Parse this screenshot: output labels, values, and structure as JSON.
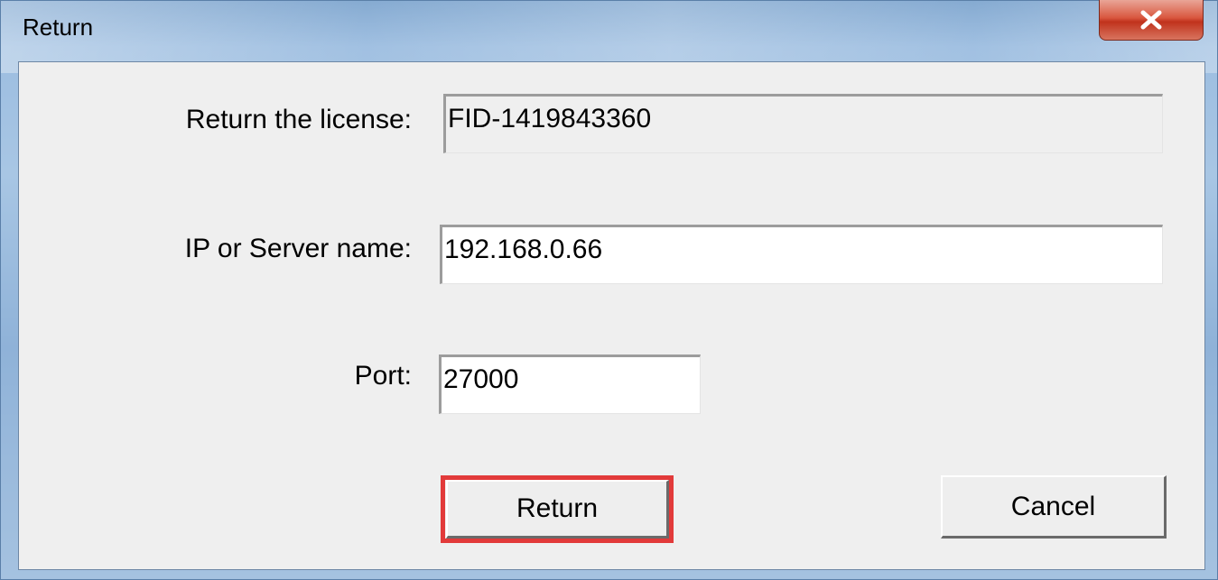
{
  "window": {
    "title": "Return",
    "close_icon": "close-icon"
  },
  "form": {
    "license_label": "Return the license:",
    "license_value": "FID-1419843360",
    "server_label": "IP or Server name:",
    "server_value": "192.168.0.66",
    "port_label": "Port:",
    "port_value": "27000"
  },
  "buttons": {
    "return_label": "Return",
    "cancel_label": "Cancel"
  },
  "colors": {
    "highlight": "#e23a3a"
  }
}
